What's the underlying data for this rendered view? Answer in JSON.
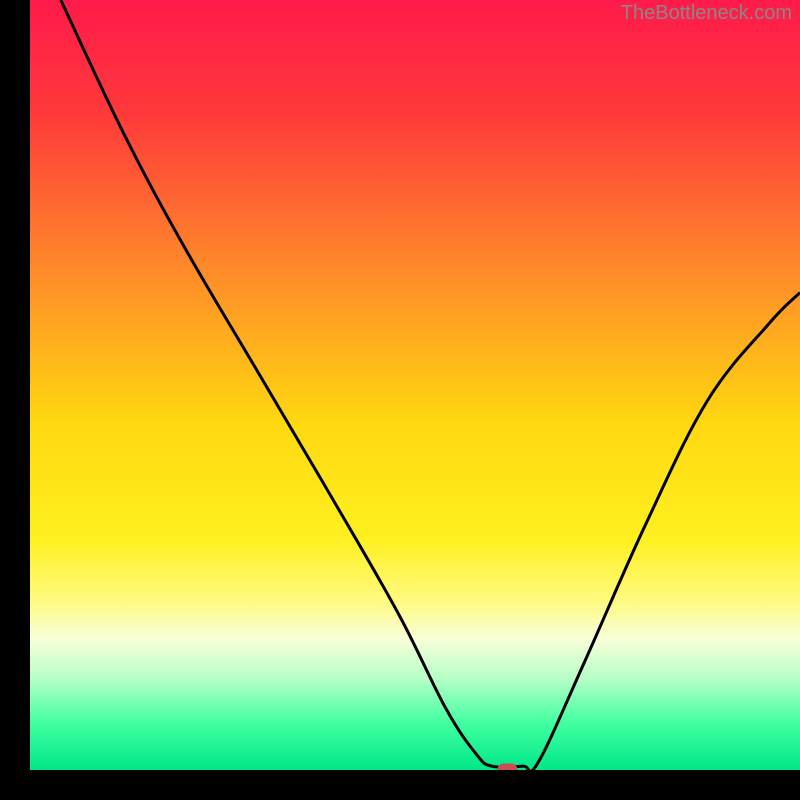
{
  "watermark": "TheBottleneck.com",
  "chart_data": {
    "type": "line",
    "title": "",
    "xlabel": "",
    "ylabel": "",
    "xlim": [
      0,
      100
    ],
    "ylim": [
      0,
      100
    ],
    "background_gradient": {
      "stops": [
        {
          "offset": 0,
          "color": "#ff1a4a"
        },
        {
          "offset": 15,
          "color": "#ff3a3a"
        },
        {
          "offset": 35,
          "color": "#ff8a2a"
        },
        {
          "offset": 55,
          "color": "#ffd810"
        },
        {
          "offset": 70,
          "color": "#fff020"
        },
        {
          "offset": 78,
          "color": "#fffa80"
        },
        {
          "offset": 83,
          "color": "#f8ffd8"
        },
        {
          "offset": 88,
          "color": "#b8ffc8"
        },
        {
          "offset": 94,
          "color": "#40ffa0"
        },
        {
          "offset": 100,
          "color": "#00e888"
        }
      ]
    },
    "curve_points": [
      {
        "x": 4,
        "y": 100
      },
      {
        "x": 12,
        "y": 83
      },
      {
        "x": 20,
        "y": 68
      },
      {
        "x": 30,
        "y": 51
      },
      {
        "x": 40,
        "y": 34
      },
      {
        "x": 48,
        "y": 20
      },
      {
        "x": 54,
        "y": 8
      },
      {
        "x": 58,
        "y": 2
      },
      {
        "x": 60,
        "y": 0.5
      },
      {
        "x": 64,
        "y": 0.5
      },
      {
        "x": 66,
        "y": 1
      },
      {
        "x": 72,
        "y": 14
      },
      {
        "x": 80,
        "y": 32
      },
      {
        "x": 88,
        "y": 48
      },
      {
        "x": 96,
        "y": 58
      },
      {
        "x": 100,
        "y": 62
      }
    ],
    "marker": {
      "x": 62,
      "y": 0,
      "color": "#c85050"
    },
    "plot_frame": {
      "left_pct": 3.75,
      "right_pct": 100,
      "top_pct": 0,
      "bottom_pct": 96.25,
      "border_color": "#000"
    }
  }
}
